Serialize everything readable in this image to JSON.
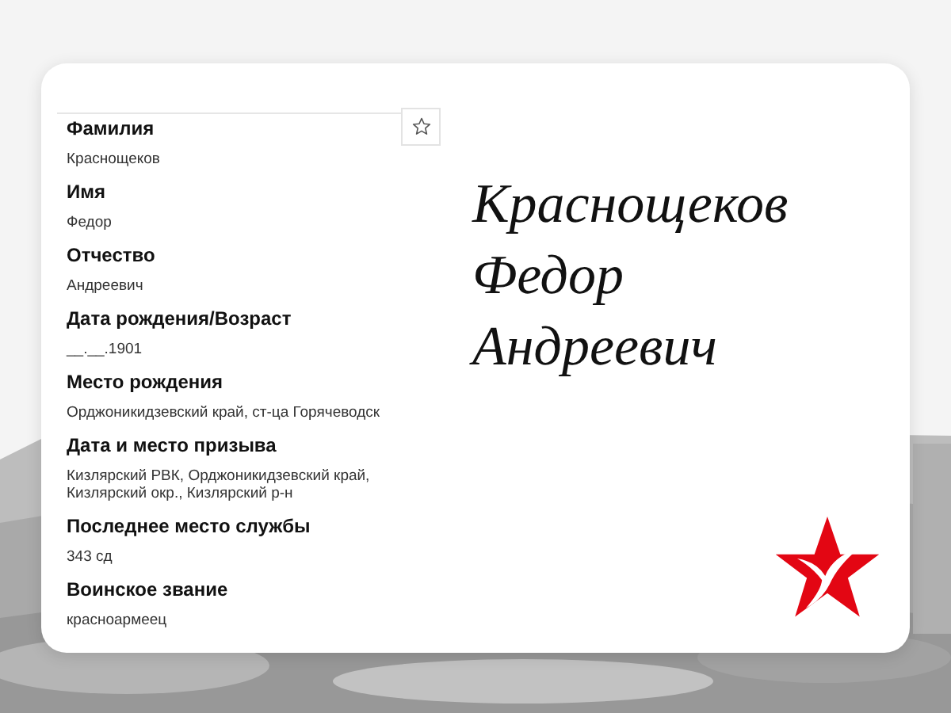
{
  "fields": [
    {
      "label": "Фамилия",
      "value": "Краснощеков"
    },
    {
      "label": "Имя",
      "value": "Федор"
    },
    {
      "label": "Отчество",
      "value": "Андреевич"
    },
    {
      "label": "Дата рождения/Возраст",
      "value": "__.__.1901"
    },
    {
      "label": "Место рождения",
      "value": "Орджоникидзевский край, ст-ца Горячеводск"
    },
    {
      "label": "Дата и место призыва",
      "value": "Кизлярский РВК, Орджоникидзевский край, Кизлярский окр., Кизлярский р-н"
    },
    {
      "label": "Последнее место службы",
      "value": "343 сд"
    },
    {
      "label": "Воинское звание",
      "value": "красноармеец"
    }
  ],
  "name_lines": [
    "Краснощеков",
    "Федор",
    "Андреевич"
  ]
}
